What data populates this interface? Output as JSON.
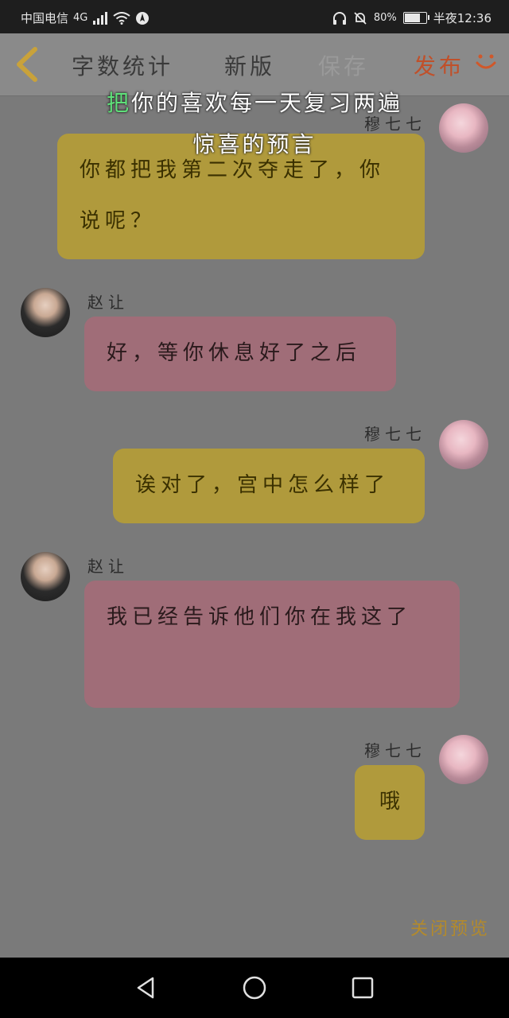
{
  "status_bar": {
    "carrier": "中国电信",
    "network": "4G",
    "battery_percent": "80%",
    "battery_level": 0.8,
    "time_label": "半夜12:36"
  },
  "toolbar": {
    "word_count_label": "字数统计",
    "new_label": "新版",
    "save_label": "保存",
    "publish_label": "发布"
  },
  "overlay": {
    "line1_highlight": "把",
    "line1_rest": "你的喜欢每一天复习两遍",
    "line2": "惊喜的预言"
  },
  "messages": [
    {
      "sender": "穆七七",
      "side": "self",
      "text": "你都把我第二次夺走了，你说呢？"
    },
    {
      "sender": "赵让",
      "side": "other",
      "text": "好，等你休息好了之后"
    },
    {
      "sender": "穆七七",
      "side": "self",
      "text": "诶对了，宫中怎么样了"
    },
    {
      "sender": "赵让",
      "side": "other",
      "text": "我已经告诉他们你在我这了"
    },
    {
      "sender": "穆七七",
      "side": "self",
      "text": "哦"
    }
  ],
  "preview": {
    "close_label": "关闭预览"
  },
  "colors": {
    "self_bubble": "#b09a3c",
    "other_bubble": "#a06d78",
    "publish": "#c0502a",
    "highlight": "#5fe07a"
  }
}
